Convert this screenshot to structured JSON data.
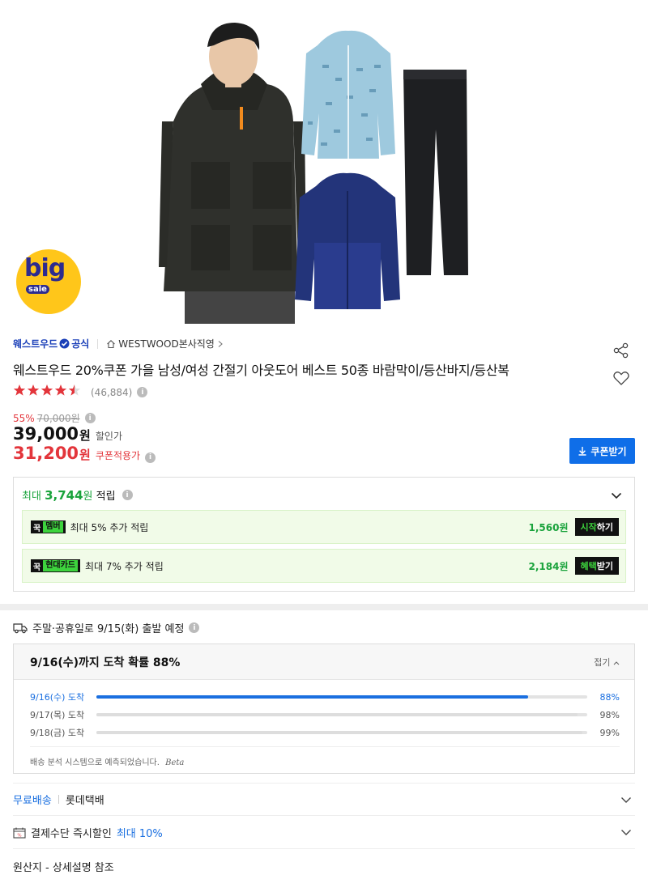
{
  "badge": {
    "big": "big",
    "sale": "sale"
  },
  "seller": {
    "brand": "웨스트우드",
    "official": "공식",
    "store": "WESTWOOD본사직영"
  },
  "product": {
    "title": "웨스트우드 20%쿠폰 가을 남성/여성 간절기 아웃도어 베스트 50종 바람막이/등산바지/등산복",
    "rating_count": "(46,884)",
    "stars": 4.5
  },
  "price": {
    "discount_rate": "55%",
    "original": "70,000원",
    "sale_num": "39,000",
    "sale_unit": "원",
    "sale_label": "할인가",
    "coupon_num": "31,200",
    "coupon_unit": "원",
    "coupon_label": "쿠폰적용가",
    "coupon_button": "쿠폰받기"
  },
  "reward": {
    "head_prefix": "최대",
    "head_amount": "3,744",
    "head_unit": "원",
    "head_suffix": "적립",
    "items": [
      {
        "kkok": "꾹",
        "tag": "멤버",
        "text": "최대 5% 추가 적립",
        "value": "1,560원",
        "action_hl": "시작",
        "action": "하기"
      },
      {
        "kkok": "꾹",
        "tag": "현대카드",
        "text": "최대 7% 추가 적립",
        "value": "2,184원",
        "action_hl": "혜택",
        "action": "받기"
      }
    ]
  },
  "shipping": {
    "notice": "주말·공휴일로 9/15(화) 출발 예정",
    "prob_title": "9/16(수)까지 도착 확률 88%",
    "fold": "접기",
    "rows": [
      {
        "date": "9/16(수) 도착",
        "percent": "88%",
        "value": 0.88
      },
      {
        "date": "9/17(목) 도착",
        "percent": "98%",
        "value": 0.98
      },
      {
        "date": "9/18(금) 도착",
        "percent": "99%",
        "value": 0.99
      }
    ],
    "note": "배송 분석 시스템으로 예측되었습니다.",
    "beta": "Beta",
    "free": "무료배송",
    "carrier": "롯데택배"
  },
  "payment": {
    "text": "결제수단 즉시할인",
    "highlight": "최대 10%"
  },
  "origin": "원산지 - 상세설명 참조",
  "colors": {
    "accent_blue": "#0f6ee8",
    "sale_red": "#e3353b",
    "reward_green": "#1aa33c",
    "badge_yellow": "#ffc61a"
  }
}
